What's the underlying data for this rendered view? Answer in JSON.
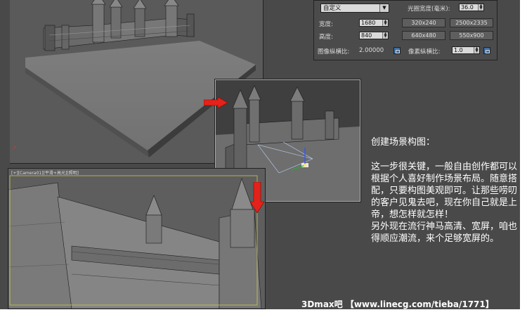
{
  "render_panel": {
    "preset_select": "自定义",
    "aperture_label": "光圈宽度(毫米):",
    "aperture_value": "36.0",
    "width_label": "宽度:",
    "width_value": "1680",
    "height_label": "高度:",
    "height_value": "840",
    "presets": [
      "320x240",
      "2500x2335",
      "640x480",
      "550x900"
    ],
    "image_aspect_label": "图像纵横比:",
    "image_aspect_value": "2.00000",
    "pixel_aspect_label": "像素纵横比:",
    "pixel_aspect_value": "1.0"
  },
  "viewport_bottom_label": "[+][Camera01][平滑+高光][照明]",
  "info": {
    "title": "创建场景构图：",
    "paragraphs": [
      "这一步很关键，一般自由创作都可以根据个人喜好制作场景布局。随意搭配，只要构图美观即可。让那些唠叨的客户见鬼去吧，现在你自己就是上帝，想怎样就怎样！",
      "另外现在流行神马高清、宽屏，咱也得顺应潮流，来个足够宽屏的。"
    ]
  },
  "footer": "3Dmax吧 【www.linecg.com/tieba/1771】",
  "colors": {
    "arrow": "#e3231b",
    "background": "#494949"
  }
}
